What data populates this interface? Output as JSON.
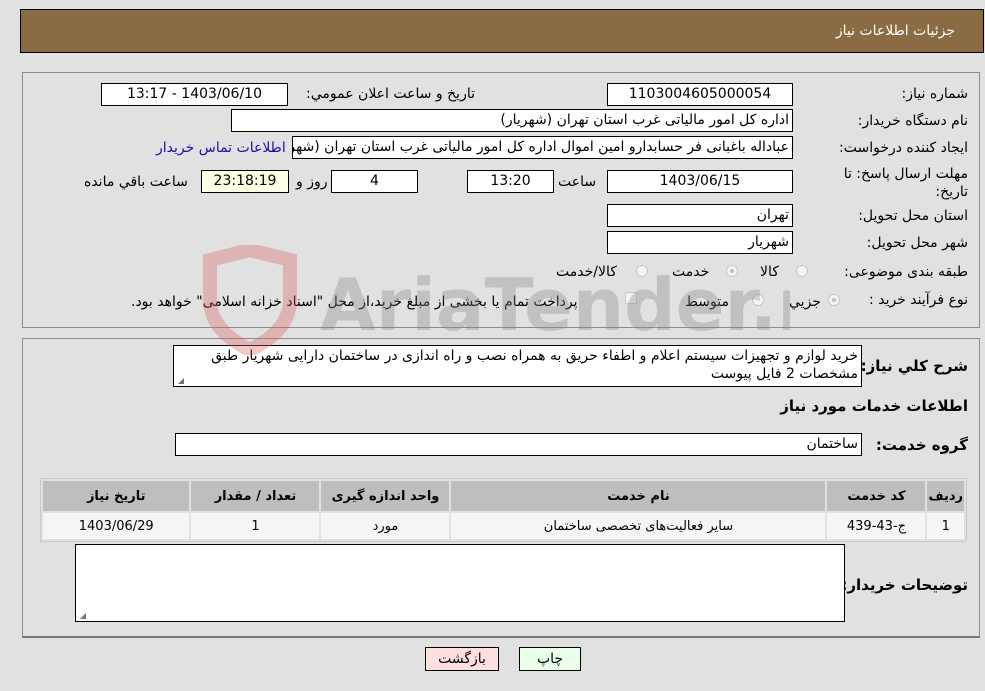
{
  "header": {
    "title": "جزئیات اطلاعات نیاز"
  },
  "details": {
    "need_number_label": "شماره نیاز:",
    "need_number": "1103004605000054",
    "announce_label": "تاریخ و ساعت اعلان عمومي:",
    "announce_value": "1403/06/10 - 13:17",
    "buyer_org_label": "نام دستگاه خريدار:",
    "buyer_org": "اداره کل امور مالیاتی غرب استان تهران (شهریار)",
    "creator_label": "ايجاد کننده درخواست:",
    "creator": "عباداله باغبانی فر حسابدارو امین اموال اداره کل امور مالیاتی غرب استان تهران (شهریار)",
    "contact_link": "اطلاعات تماس خريدار",
    "deadline_label": "مهلت ارسال پاسخ: تا تاریخ:",
    "deadline_date": "1403/06/15",
    "time_label": "ساعت",
    "deadline_time": "13:20",
    "days_value": "4",
    "days_label": "روز و",
    "remaining_time": "23:18:19",
    "remaining_label": "ساعت باقي مانده",
    "province_label": "استان محل تحويل:",
    "province": "تهران",
    "city_label": "شهر محل تحويل:",
    "city": "شهريار",
    "category_label": "طبقه بندی موضوعی:",
    "category_options": [
      {
        "label": "کالا",
        "checked": false
      },
      {
        "label": "خدمت",
        "checked": true
      },
      {
        "label": "کالا/خدمت",
        "checked": false
      }
    ],
    "process_label": "نوع فرآيند خريد :",
    "process_options": [
      {
        "label": "جزيي",
        "checked": true
      },
      {
        "label": "متوسط",
        "checked": false
      }
    ],
    "treasury_note": "پرداخت تمام يا بخشی از مبلغ خريد،از محل \"اسناد خزانه اسلامی\" خواهد بود."
  },
  "summary": {
    "description_label": "شرح کلي نياز:",
    "description": "خرید لوازم و تجهیزات سیستم اعلام و اطفاء حریق به همراه نصب و راه اندازی در ساختمان دارایی شهریار طبق مشخصات 2 فایل پیوست",
    "services_heading": "اطلاعات خدمات مورد نياز",
    "service_group_label": "گروه خدمت:",
    "service_group": "ساختمان"
  },
  "table": {
    "headers": [
      "رديف",
      "کد خدمت",
      "نام خدمت",
      "واحد اندازه گيری",
      "تعداد / مقدار",
      "تاريخ نياز"
    ],
    "rows": [
      [
        "1",
        "ج-43-439",
        "سایر فعالیت‌های تخصصی ساختمان",
        "مورد",
        "1",
        "1403/06/29"
      ]
    ]
  },
  "buyer_notes": {
    "label": "توضيحات خريدار:",
    "value": ""
  },
  "buttons": {
    "print": "چاپ",
    "back": "بازگشت"
  },
  "watermark": {
    "text": "AriaTender.neT"
  }
}
